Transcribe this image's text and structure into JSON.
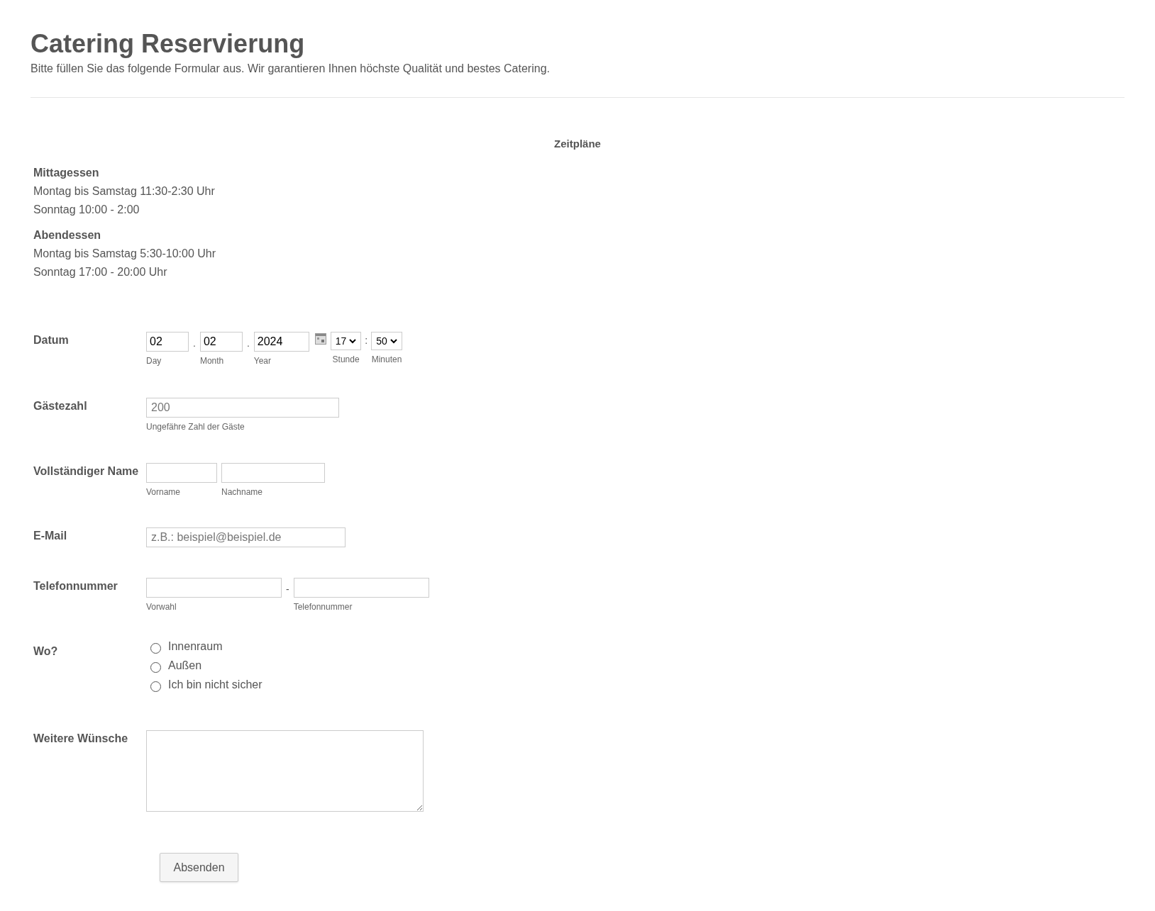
{
  "header": {
    "title": "Catering Reservierung",
    "subtitle": "Bitte füllen Sie das folgende Formular aus. Wir garantieren Ihnen höchste Qualität und bestes Catering."
  },
  "schedule": {
    "heading": "Zeitpläne",
    "sections": [
      {
        "title": "Mittagessen",
        "lines": [
          "Montag bis Samstag 11:30-2:30 Uhr",
          "Sonntag 10:00 - 2:00"
        ]
      },
      {
        "title": "Abendessen",
        "lines": [
          "Montag bis Samstag 5:30-10:00 Uhr",
          "Sonntag 17:00 - 20:00 Uhr"
        ]
      }
    ]
  },
  "fields": [
    {
      "kind": "date",
      "label": "Datum",
      "day": {
        "value": "02",
        "sublabel": "Day"
      },
      "sep_1": ".",
      "month": {
        "value": "02",
        "sublabel": "Month"
      },
      "sep_2": ".",
      "year": {
        "value": "2024",
        "sublabel": "Year"
      },
      "hour": {
        "value": "17",
        "sublabel": "Stunde"
      },
      "time_sep": ":",
      "minute": {
        "value": "50",
        "sublabel": "Minuten"
      }
    },
    {
      "kind": "text",
      "label": "Gästezahl",
      "inputs": [
        {
          "placeholder": "200",
          "sublabel": "Ungefähre Zahl der Gäste"
        }
      ]
    },
    {
      "kind": "text",
      "label": "Vollständiger Name",
      "inputs": [
        {
          "sublabel": "Vorname"
        },
        {
          "sublabel": "Nachname"
        }
      ]
    },
    {
      "kind": "text",
      "label": "E-Mail",
      "inputs": [
        {
          "placeholder": "z.B.: beispiel@beispiel.de"
        }
      ]
    },
    {
      "kind": "phone",
      "label": "Telefonnummer",
      "separator": "-",
      "inputs": [
        {
          "sublabel": "Vorwahl"
        },
        {
          "sublabel": "Telefonnummer"
        }
      ]
    },
    {
      "kind": "radio",
      "label": "Wo?",
      "options": [
        {
          "label": "Innenraum",
          "selected": false
        },
        {
          "label": "Außen",
          "selected": false
        },
        {
          "label": "Ich bin nicht sicher",
          "selected": false
        }
      ]
    },
    {
      "kind": "textarea",
      "label": "Weitere Wünsche"
    }
  ],
  "submit": "Absenden"
}
